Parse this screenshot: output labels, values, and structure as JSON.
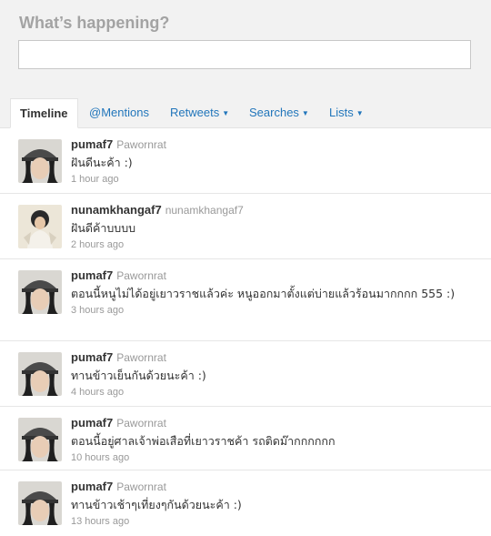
{
  "composer": {
    "prompt": "What’s happening?",
    "value": ""
  },
  "tabs": [
    {
      "label": "Timeline",
      "active": true
    },
    {
      "label": "@Mentions"
    },
    {
      "label": "Retweets",
      "dropdown": true
    },
    {
      "label": "Searches",
      "dropdown": true
    },
    {
      "label": "Lists",
      "dropdown": true
    }
  ],
  "tweets": [
    {
      "screen_name": "pumaf7",
      "full_name": "Pawornrat",
      "text": "ฝันดีนะค้า :)",
      "time": "1 hour ago",
      "avatar": "photo-girl-cap"
    },
    {
      "screen_name": "nunamkhangaf7",
      "full_name": "nunamkhangaf7",
      "text": "ฝันดีค้าบบบบ",
      "time": "2 hours ago",
      "avatar": "photo-person-light"
    },
    {
      "screen_name": "pumaf7",
      "full_name": "Pawornrat",
      "text": "ตอนนี้หนูไม่ได้อยู่เยาวราชแล้วค่ะ หนูออกมาตั้งแต่บ่ายแล้วร้อนมากกกก 555 :)",
      "time": "3 hours ago",
      "avatar": "photo-girl-cap"
    },
    {
      "screen_name": "pumaf7",
      "full_name": "Pawornrat",
      "text": "ทานข้าวเย็นกันด้วยนะค้า :)",
      "time": "4 hours ago",
      "avatar": "photo-girl-cap"
    },
    {
      "screen_name": "pumaf7",
      "full_name": "Pawornrat",
      "text": "ตอนนี้อยู่ศาลเจ้าพ่อเสือที่เยาวราชค้า รถติดม๊ากกกกกก",
      "time": "10 hours ago",
      "avatar": "photo-girl-cap"
    },
    {
      "screen_name": "pumaf7",
      "full_name": "Pawornrat",
      "text": "ทานข้าวเช้าๆเที่ยงๆกันด้วยนะค้า :)",
      "time": "13 hours ago",
      "avatar": "photo-girl-cap"
    }
  ]
}
